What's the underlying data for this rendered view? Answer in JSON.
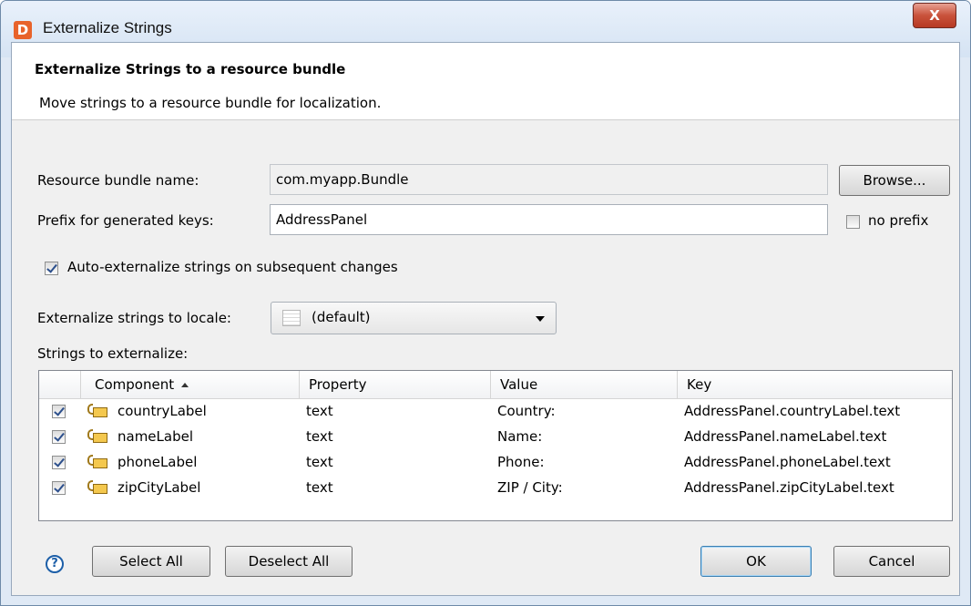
{
  "window": {
    "title": "Externalize Strings",
    "app_icon_letter": "D",
    "close_glyph": "X"
  },
  "header": {
    "title": "Externalize Strings to a resource bundle",
    "description": "Move strings to a resource bundle for localization."
  },
  "form": {
    "bundle_label": "Resource bundle name:",
    "bundle_value": "com.myapp.Bundle",
    "browse_label": "Browse...",
    "prefix_label": "Prefix for generated keys:",
    "prefix_value": "AddressPanel",
    "no_prefix_label": "no prefix",
    "no_prefix_checked": false,
    "auto_label": "Auto-externalize strings on subsequent changes",
    "auto_checked": true,
    "locale_label": "Externalize strings to locale:",
    "locale_value": "(default)",
    "strings_label": "Strings to externalize:"
  },
  "table": {
    "columns": [
      "Component",
      "Property",
      "Value",
      "Key"
    ],
    "sorted_column": "Component",
    "rows": [
      {
        "checked": true,
        "component": "countryLabel",
        "property": "text",
        "value": "Country:",
        "key": "AddressPanel.countryLabel.text"
      },
      {
        "checked": true,
        "component": "nameLabel",
        "property": "text",
        "value": "Name:",
        "key": "AddressPanel.nameLabel.text"
      },
      {
        "checked": true,
        "component": "phoneLabel",
        "property": "text",
        "value": "Phone:",
        "key": "AddressPanel.phoneLabel.text"
      },
      {
        "checked": true,
        "component": "zipCityLabel",
        "property": "text",
        "value": "ZIP / City:",
        "key": "AddressPanel.zipCityLabel.text"
      }
    ]
  },
  "footer": {
    "help_glyph": "?",
    "select_all_label": "Select All",
    "deselect_all_label": "Deselect All",
    "ok_label": "OK",
    "cancel_label": "Cancel"
  },
  "colors": {
    "accent": "#3c7fb1",
    "close_button": "#c9523b",
    "app_icon": "#e8632b"
  }
}
